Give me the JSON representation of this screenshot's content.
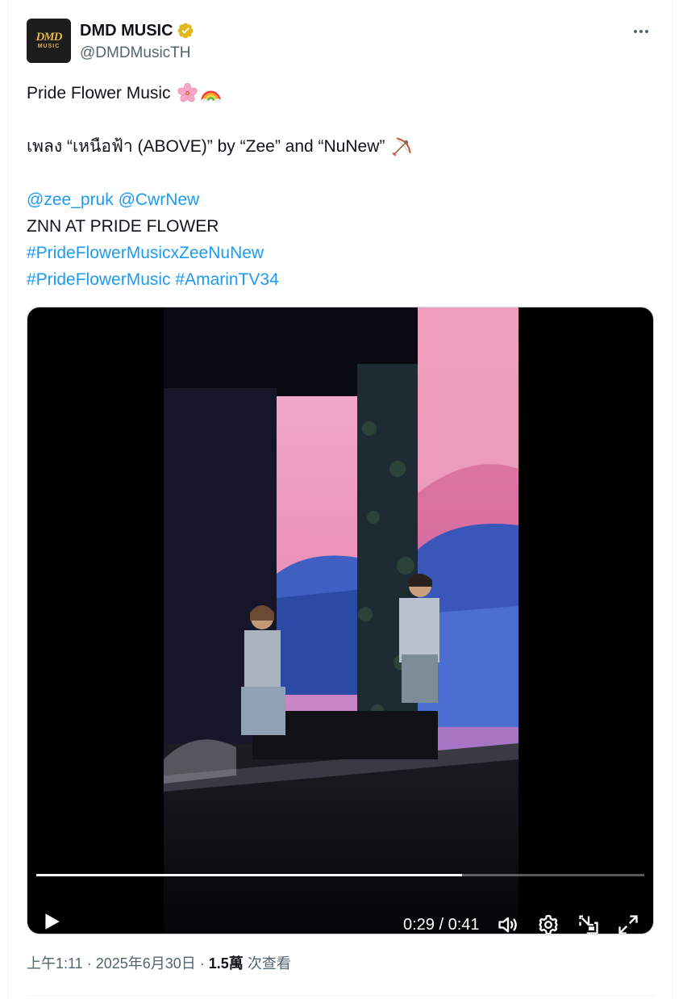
{
  "author": {
    "name": "DMD MUSIC",
    "handle": "@DMDMusicTH",
    "avatar_top": "DMD",
    "avatar_bottom": "MUSIC",
    "verified_color": "#e2b719"
  },
  "tweet": {
    "line1": "Pride Flower Music",
    "line1_emoji": [
      "cherry-blossom-emoji",
      "rainbow-emoji"
    ],
    "line2": "เพลง “เหนือฟ้า (ABOVE)” by “Zee” and “NuNew”",
    "line2_emoji": "bow-and-arrow-emoji",
    "mention1": "@zee_pruk",
    "mention2": "@CwrNew",
    "line4": "ZNN AT PRIDE FLOWER",
    "hashtag1": "#PrideFlowerMusicxZeeNuNew",
    "hashtag2": "#PrideFlowerMusic",
    "hashtag3": "#AmarinTV34"
  },
  "video": {
    "current_time": "0:29",
    "duration": "0:41",
    "time_display": "0:29 / 0:41",
    "progress": 0.7,
    "controls": [
      "play-icon",
      "volume-icon",
      "settings-icon",
      "picture-in-picture-icon",
      "fullscreen-icon"
    ]
  },
  "meta": {
    "time": "上午1:11",
    "separator1": " · ",
    "date": "2025年6月30日",
    "separator2": " · ",
    "views": "1.5萬",
    "views_label": " 次查看"
  },
  "colors": {
    "link": "#1d9bf0",
    "secondary_text": "#536471"
  }
}
